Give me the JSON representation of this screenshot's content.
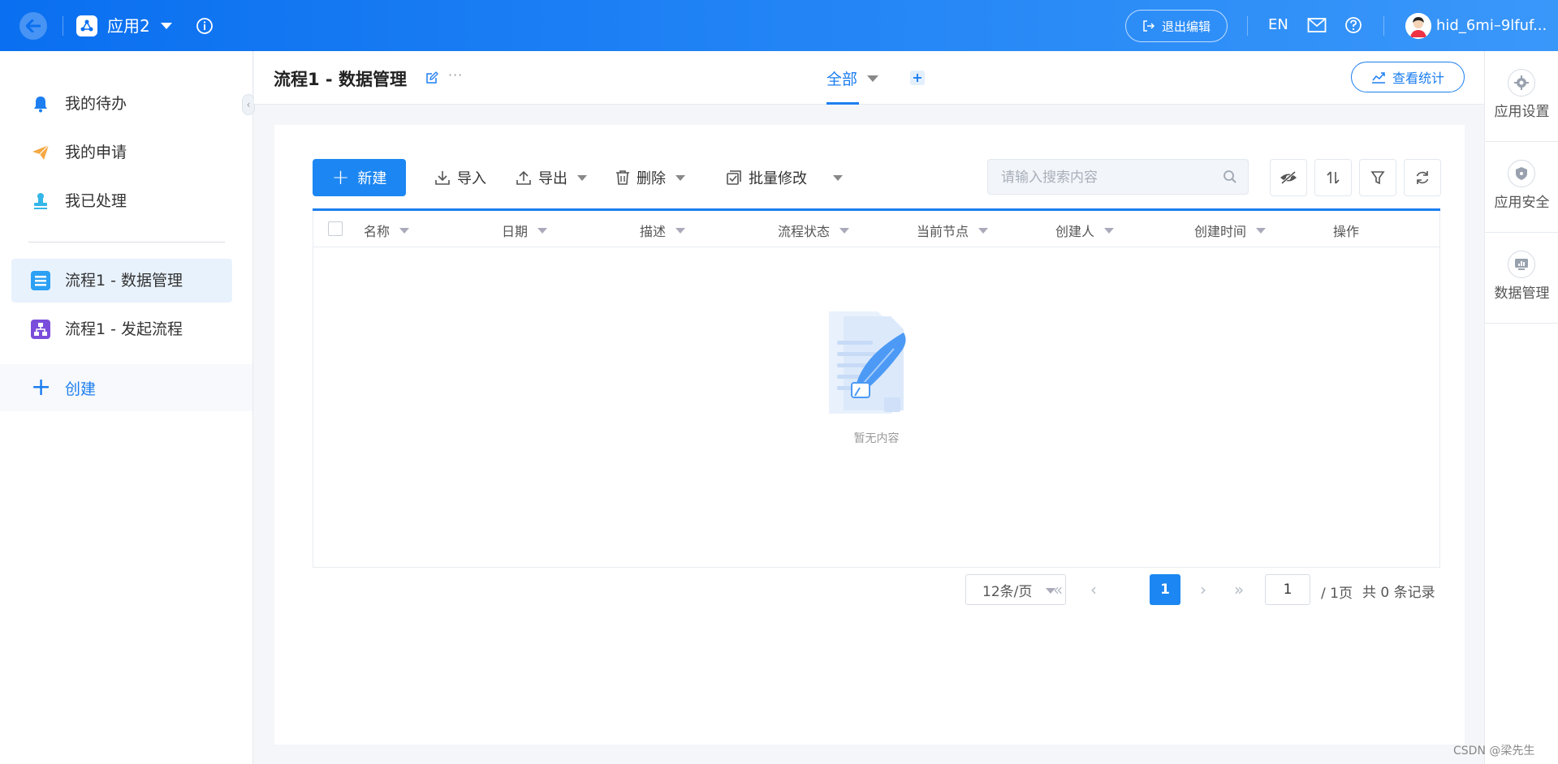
{
  "header": {
    "app_name": "应用2",
    "exit_edit_label": "退出编辑",
    "lang_label": "EN",
    "user_name": "hid_6mi–9lfuf..."
  },
  "sidebar": {
    "items": [
      {
        "label": "我的待办",
        "icon": "bell-icon",
        "color": "#1c7ef0"
      },
      {
        "label": "我的申请",
        "icon": "paper-plane-icon",
        "color": "#f5a742"
      },
      {
        "label": "我已处理",
        "icon": "stamp-icon",
        "color": "#34b6e8"
      },
      {
        "label": "流程1 - 数据管理",
        "icon": "form-list-icon",
        "color": "#2ba0f4",
        "active": true
      },
      {
        "label": "流程1 - 发起流程",
        "icon": "flow-chart-icon",
        "color": "#7b4ddb"
      }
    ],
    "create_label": "创建"
  },
  "page": {
    "title": "流程1 - 数据管理",
    "tab_all": "全部",
    "stats_label": "查看统计"
  },
  "rail": {
    "items": [
      {
        "label": "应用设置",
        "icon": "gear-icon"
      },
      {
        "label": "应用安全",
        "icon": "shield-icon"
      },
      {
        "label": "数据管理",
        "icon": "data-monitor-icon"
      }
    ]
  },
  "toolbar": {
    "new_label": "新建",
    "import_label": "导入",
    "export_label": "导出",
    "delete_label": "删除",
    "batch_edit_label": "批量修改",
    "search_placeholder": "请输入搜索内容"
  },
  "table": {
    "columns": [
      "名称",
      "日期",
      "描述",
      "流程状态",
      "当前节点",
      "创建人",
      "创建时间",
      "操作"
    ],
    "empty_text": "暂无内容"
  },
  "pagination": {
    "page_size": "12条/页",
    "current_page": "1",
    "goto_value": "1",
    "total_pages": "/ 1页",
    "total_records": "共 0 条记录"
  },
  "watermark": "CSDN @梁先生",
  "colors": {
    "primary": "#1c7ef0",
    "header_gradient_start": "#0a6ff0",
    "header_gradient_end": "#3a97fa"
  }
}
